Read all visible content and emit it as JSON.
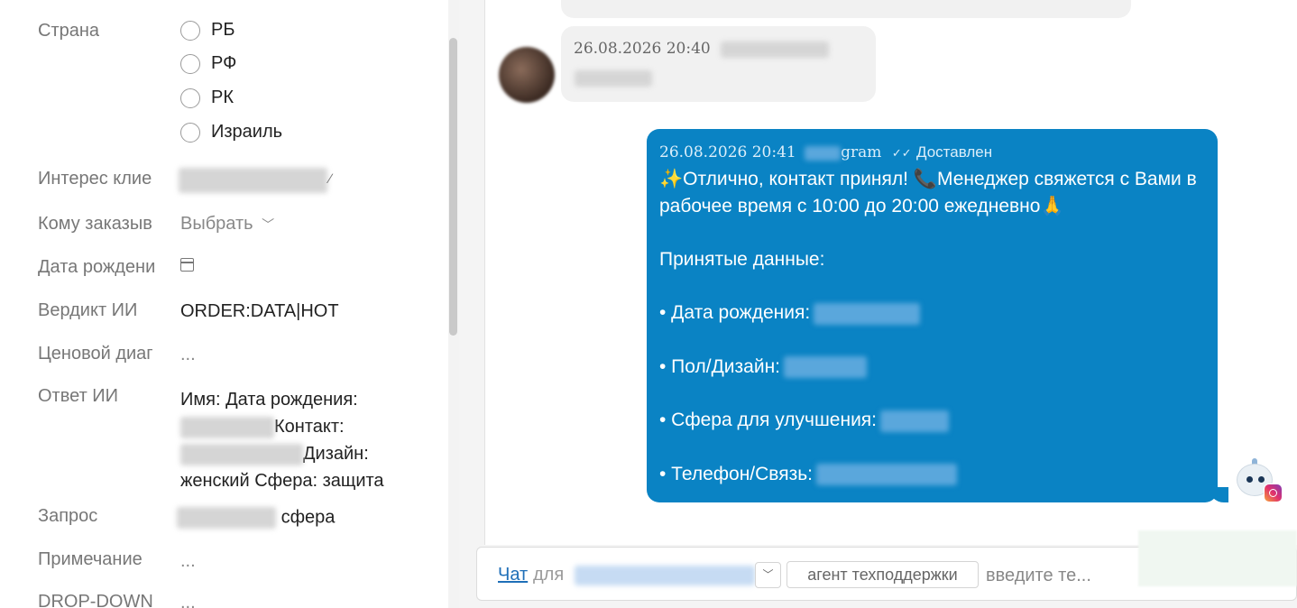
{
  "form": {
    "country": {
      "label": "Страна",
      "options": [
        "РБ",
        "РФ",
        "РК",
        "Израиль"
      ]
    },
    "interest": {
      "label": "Интерес клие"
    },
    "order_for": {
      "label": "Кому заказыв",
      "value": "Выбрать"
    },
    "birth_date": {
      "label": "Дата рождени"
    },
    "ai_verdict": {
      "label": "Вердикт ИИ",
      "value": "ORDER:DATA|HOT"
    },
    "price_diag": {
      "label": "Ценовой диаг",
      "value": "..."
    },
    "ai_answer": {
      "label": "Ответ ИИ",
      "line1": "Имя:  Дата рождения:",
      "line2": "Контакт:",
      "line3": "Дизайн:",
      "line4": "женский Сфера: защита"
    },
    "request": {
      "label": "Запрос",
      "value": "сфера"
    },
    "note": {
      "label": "Примечание",
      "value": "..."
    },
    "dropdown": {
      "label": "DROP-DOWN",
      "value": "..."
    }
  },
  "chat": {
    "incoming": {
      "timestamp": "26.08.2026 20:40"
    },
    "outgoing": {
      "timestamp": "26.08.2026 20:41",
      "channel_suffix": "gram",
      "status": "Доставлен",
      "line1": "✨Отлично, контакт принял! 📞Менеджер свяжется с Вами в",
      "line2": "рабочее время с 10:00 до 20:00 ежедневно🙏",
      "line3": "Принятые данные:",
      "line4": "• Дата рождения:",
      "line5": "• Пол/Дизайн:",
      "line6": "• Сфера для улучшения:",
      "line7": "• Телефон/Связь:"
    }
  },
  "input_bar": {
    "chat_link": "Чат",
    "for_label": "для",
    "agent_label": "агент техподдержки",
    "placeholder": "введите те..."
  }
}
